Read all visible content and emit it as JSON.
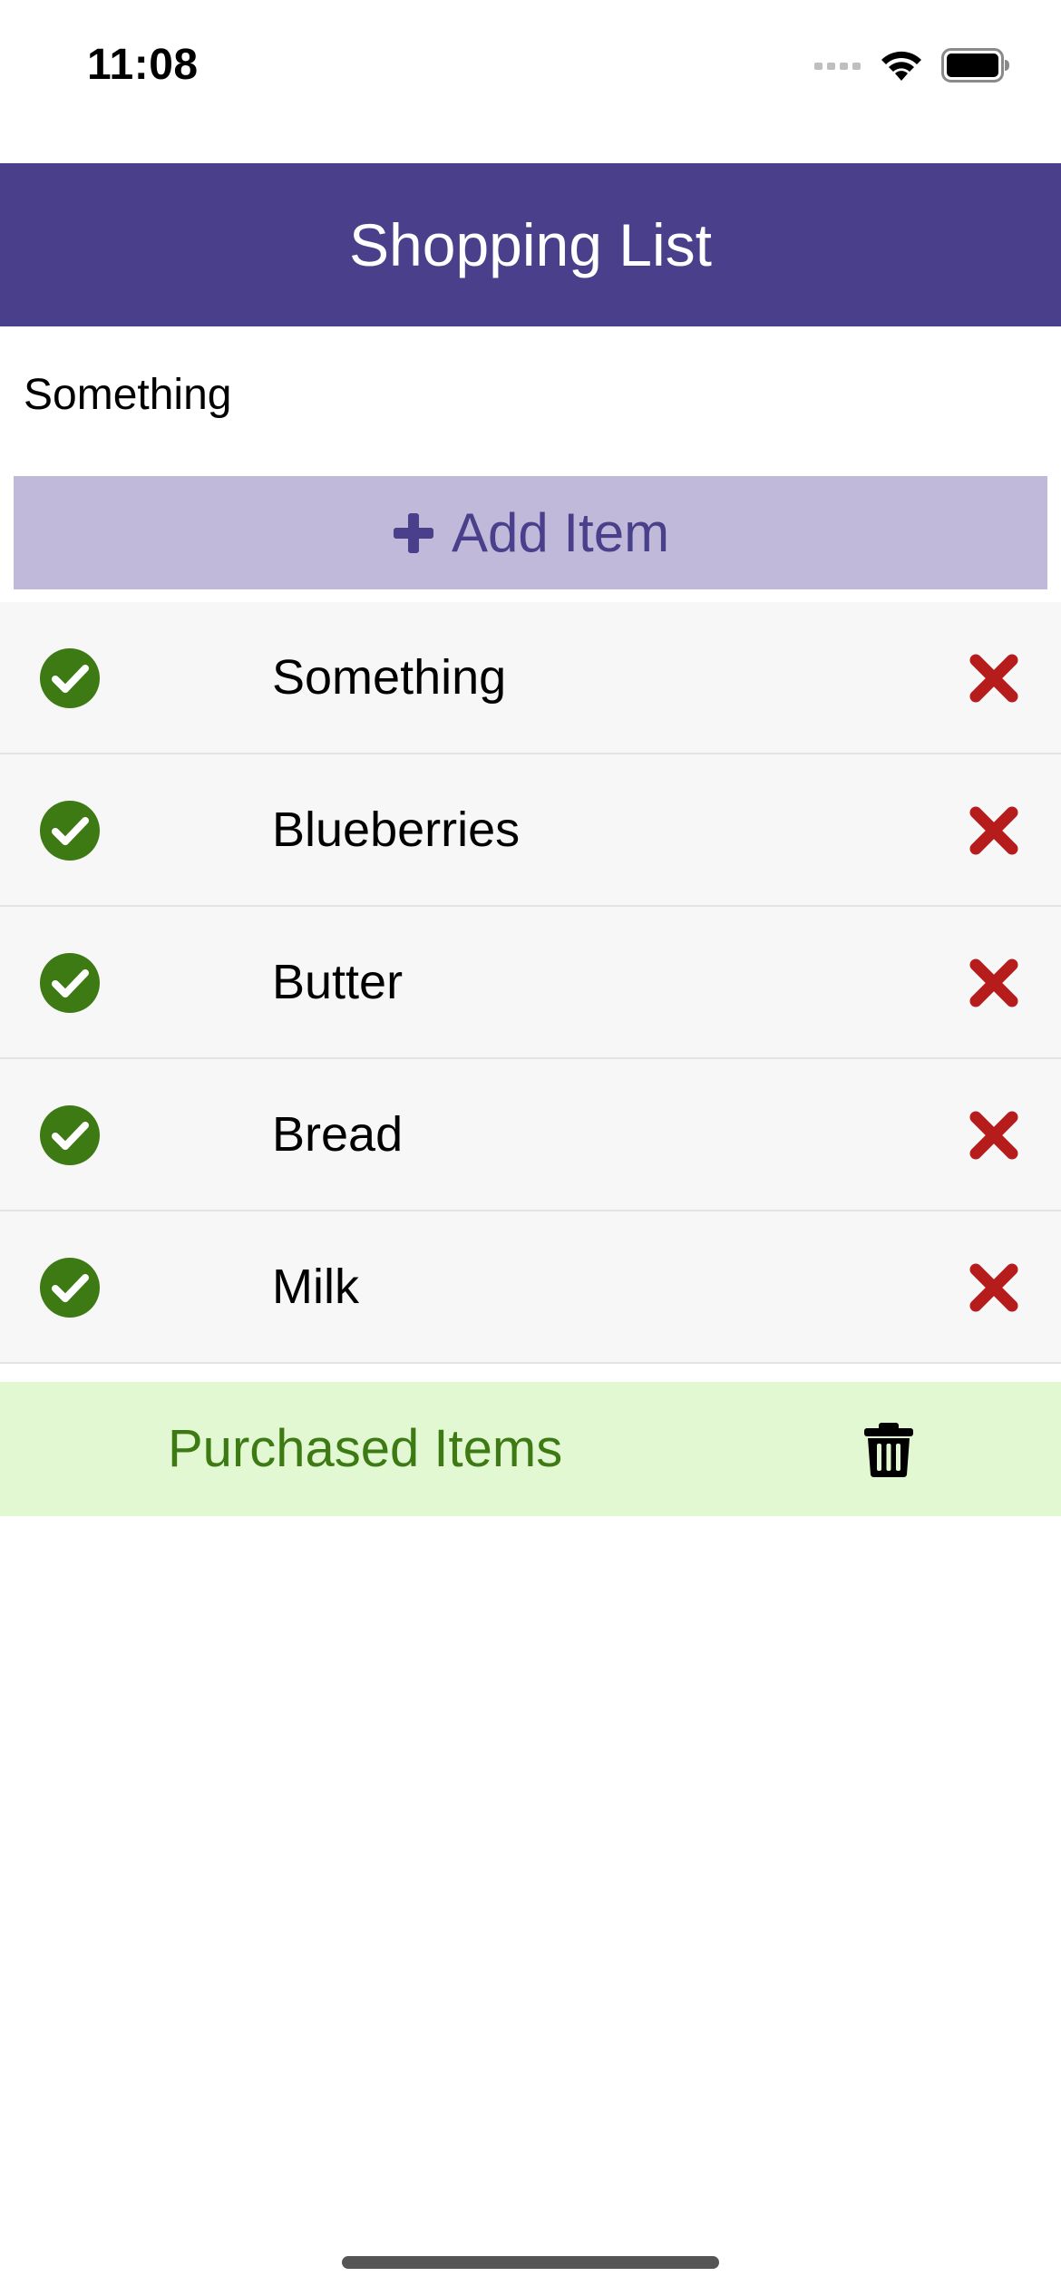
{
  "status_bar": {
    "time": "11:08",
    "icons": [
      "signal-icon",
      "wifi-icon",
      "battery-icon"
    ]
  },
  "header": {
    "title": "Shopping List",
    "background": "#4a3f8a"
  },
  "input": {
    "value": "Something",
    "placeholder": ""
  },
  "add_button": {
    "label": "Add Item",
    "icon": "plus-icon",
    "background": "#c1b9d9",
    "text_color": "#4a3f8a"
  },
  "items": [
    {
      "name": "Something"
    },
    {
      "name": "Blueberries"
    },
    {
      "name": "Butter"
    },
    {
      "name": "Bread"
    },
    {
      "name": "Milk"
    }
  ],
  "item_icons": {
    "check": "check-circle-icon",
    "remove": "close-icon",
    "check_color": "#3d7a14",
    "remove_color": "#b71c1c"
  },
  "purchased_bar": {
    "label": "Purchased Items",
    "icon": "trash-icon",
    "background": "#e2f8d2",
    "text_color": "#3d7a14"
  }
}
